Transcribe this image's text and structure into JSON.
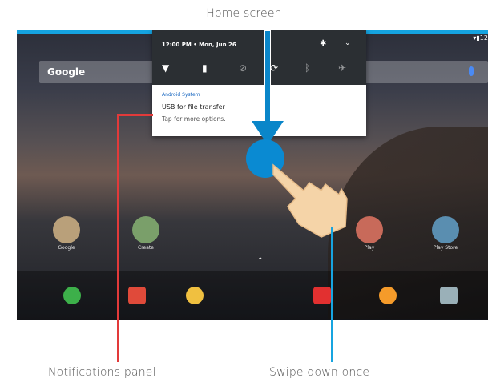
{
  "captions": {
    "top": "Home screen",
    "left": "Notifications panel",
    "right": "Swipe down once"
  },
  "status_bar": {
    "right_text": "▾▮12"
  },
  "search": {
    "logo": "Google"
  },
  "notification_panel": {
    "time_date": "12:00 PM • Mon, Jun 26",
    "notification": {
      "app": "Android System",
      "title": "USB for file transfer",
      "subtitle": "Tap for more options."
    }
  },
  "apps": [
    {
      "label": "Google",
      "color": "#c95"
    },
    {
      "label": "Create",
      "color": "#4a8"
    },
    {
      "label": "Play",
      "color": "#d66"
    },
    {
      "label": "Play Store",
      "color": "#5ab"
    }
  ],
  "colors": {
    "accent_blue": "#0a86c9",
    "line_red": "#e23a3a",
    "line_blue": "#17a4e0"
  }
}
